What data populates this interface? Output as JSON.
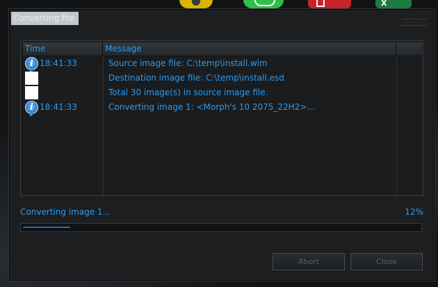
{
  "window": {
    "title": "Converting file"
  },
  "log": {
    "columns": {
      "time": "Time",
      "message": "Message",
      "extra": ""
    },
    "rows": [
      {
        "icon": "info-icon",
        "time": "18:41:33",
        "message": "Source image file: C:\\temp\\install.wim"
      },
      {
        "icon": "blank",
        "time": "",
        "message": "Destination image file: C:\\temp\\install.esd"
      },
      {
        "icon": "blank",
        "time": "",
        "message": "Total 30 image(s) in source image file."
      },
      {
        "icon": "info-icon",
        "time": "18:41:33",
        "message": "Converting image 1: <Morph's 10 2075_22H2>..."
      }
    ]
  },
  "status": {
    "text": "Converting image 1...",
    "percent_label": "12%",
    "progress": 0.12
  },
  "buttons": {
    "abort": "Abort",
    "close": "Close"
  },
  "colors": {
    "accent": "#2d9bf0",
    "dialog_bg": "#1c1e20",
    "border": "#3b3f43"
  }
}
